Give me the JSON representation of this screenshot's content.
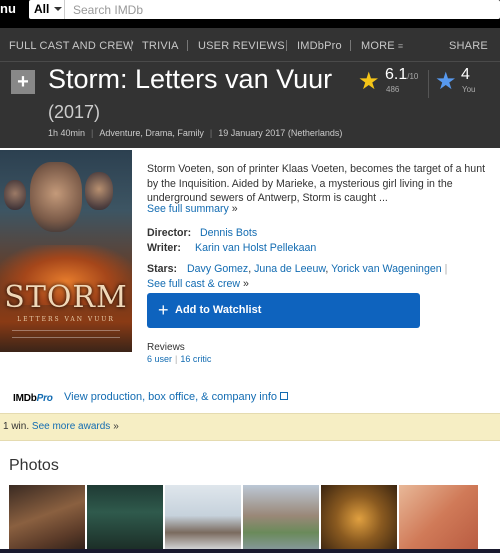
{
  "topbar": {
    "menu_text": "nu",
    "search_category": "All",
    "search_placeholder": "Search IMDb"
  },
  "subnav": {
    "items": [
      "FULL CAST AND CREW",
      "TRIVIA",
      "USER REVIEWS",
      "IMDbPro",
      "MORE"
    ],
    "share": "SHARE"
  },
  "title_block": {
    "title": "Storm: Letters van Vuur",
    "year": "(2017)",
    "runtime": "1h 40min",
    "genres": "Adventure, Drama, Family",
    "release": "19 January 2017 (Netherlands)"
  },
  "rating": {
    "value": "6.1",
    "max": "/10",
    "count": "486",
    "user_value": "4",
    "user_label": "You"
  },
  "poster": {
    "title": "STORM",
    "subtitle": "LETTERS VAN VUUR"
  },
  "summary": {
    "text": "Storm Voeten, son of printer Klaas Voeten, becomes the target of a hunt by the Inquisition. Aided by Marieke, a mysterious girl living in the underground sewers of Antwerp, Storm is caught ...",
    "see_full": "See full summary",
    "chevron": "»"
  },
  "credits": {
    "director_label": "Director:",
    "director": "Dennis Bots",
    "writer_label": "Writer:",
    "writer": "Karin van Holst Pellekaan",
    "stars_label": "Stars:",
    "stars": [
      "Davy Gomez",
      "Juna de Leeuw",
      "Yorick van Wageningen"
    ],
    "see_full_cast": "See full cast & crew",
    "chevron": "»"
  },
  "watchlist": {
    "label": "Add to Watchlist"
  },
  "reviews": {
    "label": "Reviews",
    "user": "6 user",
    "critic": "16 critic"
  },
  "imdbpro": {
    "logo_imdb": "IMDb",
    "logo_pro": "Pro",
    "link": "View production, box office, & company info"
  },
  "awards": {
    "prefix": "1 win.",
    "link": "See more awards",
    "chevron": "»"
  },
  "photos": {
    "heading": "Photos"
  },
  "colors": {
    "brand_yellow": "#f5c518",
    "link_blue": "#136cb2",
    "button_blue": "#0e63be",
    "header_bg": "#333333",
    "award_bg": "#f6eec4"
  }
}
